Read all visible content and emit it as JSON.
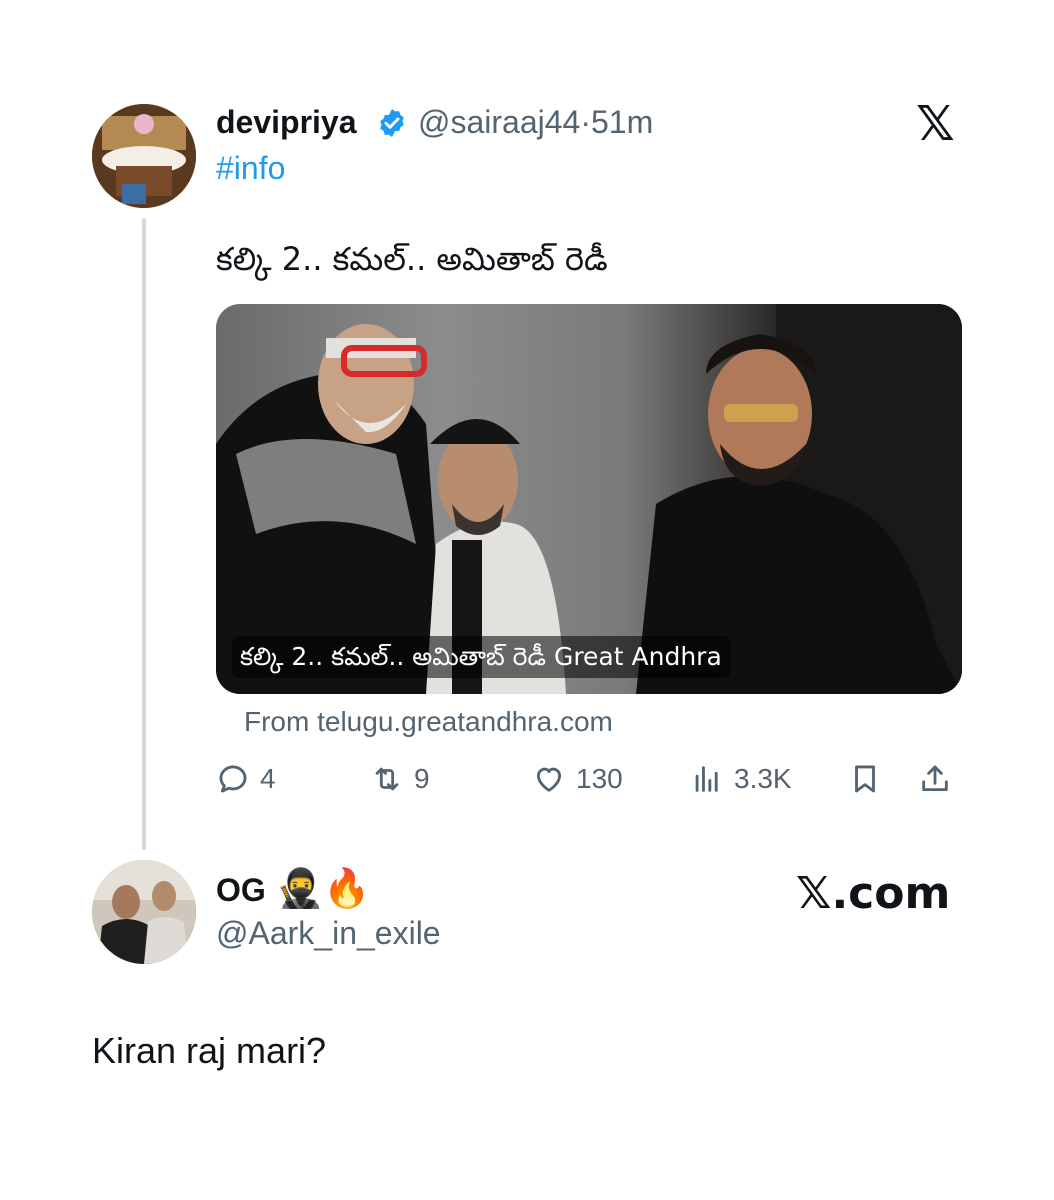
{
  "tweet": {
    "author_name": "devipriya",
    "author_handle": "@sairaaj44",
    "separator": "·",
    "time": "51m",
    "hashtag": "#info",
    "text": "కల్కి 2.. కమల్.. అమితాబ్ రెడీ",
    "media_caption": "కల్కి 2.. కమల్.. అమితాబ్ రెడీ Great Andhra",
    "source": "From telugu.greatandhra.com",
    "stats": {
      "replies": "4",
      "retweets": "9",
      "likes": "130",
      "views": "3.3K"
    }
  },
  "reply_account": {
    "name": "OG",
    "emoji": "🥷🔥",
    "handle": "@Aark_in_exile",
    "text": "Kiran raj mari?"
  },
  "branding": {
    "x_logo": "𝕏",
    "x_com": "𝕏.com"
  },
  "colors": {
    "accent": "#1d9bf0",
    "secondary_text": "#536471",
    "thread_line": "#cfd9de"
  },
  "icons": [
    "verified-badge-icon",
    "x-logo-icon",
    "reply-icon",
    "retweet-icon",
    "like-icon",
    "views-icon",
    "bookmark-icon",
    "share-icon"
  ]
}
